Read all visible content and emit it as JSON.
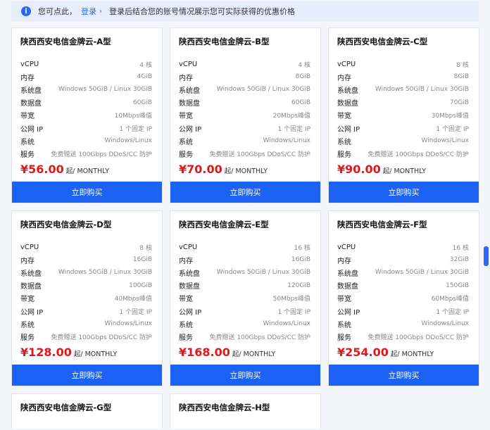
{
  "notice": {
    "prefix": "您可点此，",
    "link": "登录",
    "chevron": "›",
    "text": "登录后结合您的账号情况展示您可实际获得的优惠价格"
  },
  "spec_labels": [
    "vCPU",
    "内存",
    "系统盘",
    "数据盘",
    "带宽",
    "公网 IP",
    "系统",
    "服务"
  ],
  "buy_label": "立即购买",
  "price_unit": "起/ MONTHLY",
  "cards": [
    {
      "title": "陕西西安电信金牌云-A型",
      "specs": [
        "4 核",
        "4GiB",
        "Windows 50GiB / Linux 30GiB",
        "60GiB",
        "10Mbps峰值",
        "1 个固定 IP",
        "Windows/Linux",
        "免费赠送 100Gbps DDoS/CC 防护"
      ],
      "price": "¥56.00"
    },
    {
      "title": "陕西西安电信金牌云-B型",
      "specs": [
        "4 核",
        "8GiB",
        "Windows 50GiB / Linux 30GiB",
        "60GiB",
        "20Mbps峰值",
        "1 个固定 IP",
        "Windows/Linux",
        "免费赠送 100Gbps DDoS/CC 防护"
      ],
      "price": "¥70.00"
    },
    {
      "title": "陕西西安电信金牌云-C型",
      "specs": [
        "8 核",
        "8GiB",
        "Windows 50GiB / Linux 30GiB",
        "70GiB",
        "30Mbps峰值",
        "1 个固定 IP",
        "Windows/Linux",
        "免费赠送 100Gbps DDoS/CC 防护"
      ],
      "price": "¥90.00"
    },
    {
      "title": "陕西西安电信金牌云-D型",
      "specs": [
        "8 核",
        "16GiB",
        "Windows 50GiB / Linux 30GiB",
        "100GiB",
        "40Mbps峰值",
        "1 个固定 IP",
        "Windows/Linux",
        "免费赠送 100Gbps DDoS/CC 防护"
      ],
      "price": "¥128.00"
    },
    {
      "title": "陕西西安电信金牌云-E型",
      "specs": [
        "16 核",
        "16GiB",
        "Windows 50GiB / Linux 30GiB",
        "120GiB",
        "50Mbps峰值",
        "1 个固定 IP",
        "Windows/Linux",
        "免费赠送 100Gbps DDoS/CC 防护"
      ],
      "price": "¥168.00"
    },
    {
      "title": "陕西西安电信金牌云-F型",
      "specs": [
        "16 核",
        "32GiB",
        "Windows 50GiB / Linux 30GiB",
        "150GiB",
        "60Mbps峰值",
        "1 个固定 IP",
        "Windows/Linux",
        "免费赠送 100Gbps DDoS/CC 防护"
      ],
      "price": "¥254.00"
    }
  ],
  "partial_cards": [
    {
      "title": "陕西西安电信金牌云-G型"
    },
    {
      "title": "陕西西安电信金牌云-H型"
    }
  ],
  "colors": {
    "accent": "#1c62f5",
    "price": "#e3171a",
    "notice_bg": "#e6eefc"
  },
  "icons": {
    "notice": "info-icon",
    "link_arrow": "chevron-right-icon"
  }
}
